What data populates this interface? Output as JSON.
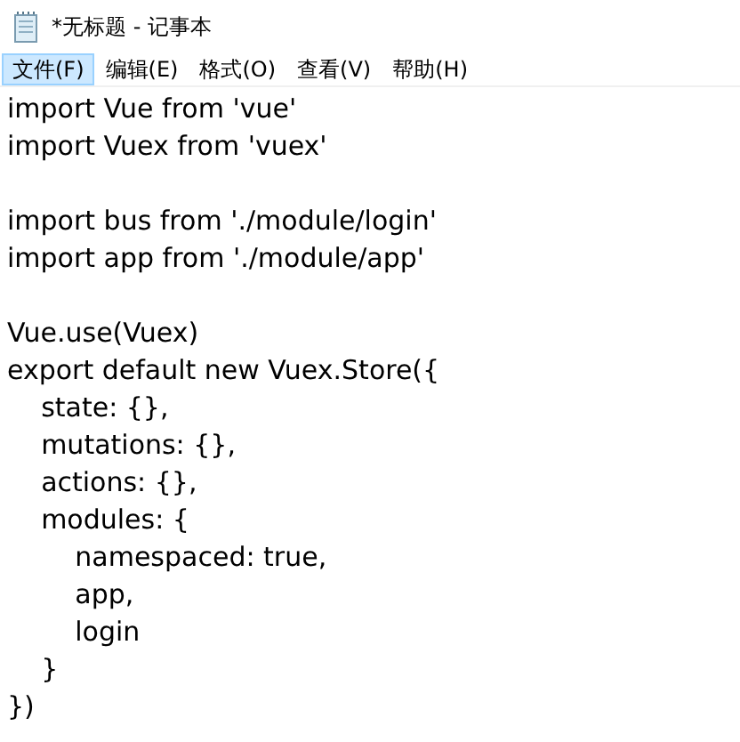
{
  "window": {
    "title": "*无标题 - 记事本"
  },
  "menu": [
    {
      "label": "文件(F)",
      "selected": true
    },
    {
      "label": "编辑(E)",
      "selected": false
    },
    {
      "label": "格式(O)",
      "selected": false
    },
    {
      "label": "查看(V)",
      "selected": false
    },
    {
      "label": "帮助(H)",
      "selected": false
    }
  ],
  "editor": {
    "lines": [
      {
        "kind": "text",
        "text": "import Vue from 'vue'"
      },
      {
        "kind": "text",
        "text": "import Vuex from 'vuex'"
      },
      {
        "kind": "blank"
      },
      {
        "kind": "text",
        "text": "import bus from './module/login'"
      },
      {
        "kind": "text",
        "text": "import app from './module/app'"
      },
      {
        "kind": "blank"
      },
      {
        "kind": "text",
        "text": "Vue.use(Vuex)"
      },
      {
        "kind": "text",
        "text": "export default new Vuex.Store({"
      },
      {
        "kind": "text",
        "text": "    state: {},"
      },
      {
        "kind": "text",
        "text": "    mutations: {},"
      },
      {
        "kind": "text",
        "text": "    actions: {},"
      },
      {
        "kind": "text",
        "text": "    modules: {"
      },
      {
        "kind": "text",
        "text": "        namespaced: true,"
      },
      {
        "kind": "text",
        "text": "        app,"
      },
      {
        "kind": "text",
        "text": "        login"
      },
      {
        "kind": "text",
        "text": "    }"
      },
      {
        "kind": "text",
        "text": "})"
      }
    ]
  }
}
